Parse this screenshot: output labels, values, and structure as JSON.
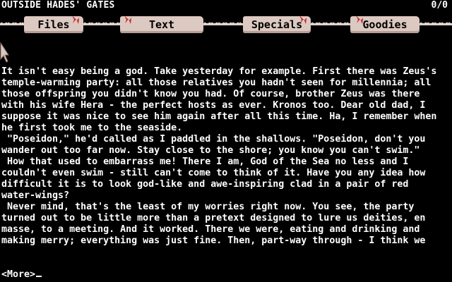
{
  "status": {
    "location": "OUTSIDE HADES' GATES",
    "score": "0/0"
  },
  "menu": {
    "items": [
      {
        "label": "Files"
      },
      {
        "label": "Text"
      },
      {
        "label": "Specials"
      },
      {
        "label": "Goodies"
      }
    ],
    "chain_glyph": "⊶⊶⊶⊶⊶⊶⊶⊶⊶⊶⊶⊶⊶⊶⊶⊶⊶⊶⊶⊶⊶⊶⊶⊶⊶⊶⊶⊶⊶⊶⊶⊶⊶⊶⊶⊶⊶⊶⊶⊶⊶⊶⊶⊶⊶⊶⊶⊶⊶⊶⊶⊶⊶⊶⊶⊶⊶⊶⊶⊶⊶⊶⊶⊶⊶⊶⊶⊶⊶⊶⊶⊶⊶⊶⊶⊶⊶⊶⊶⊶⊶",
    "tab_color": "#dcc9c1",
    "flame_color": "#c81f1f"
  },
  "story": {
    "lines": [
      "It isn't easy being a god. Take yesterday for example. First there was Zeus's",
      "temple-warming party: all those relatives you hadn't seen for millennia; all",
      "those offspring you didn't know you had. Of course, brother Zeus was there",
      "with his wife Hera - the perfect hosts as ever. Kronos too. Dear old dad, I",
      "suppose it was nice to see him again after all this time. Ha, I remember when",
      "he first took me to the seaside.",
      " \"Poseidon,\" he'd called as I paddled in the shallows. \"Poseidon, don't you",
      "wander out too far now. Stay close to the shore; you know you can't swim.\"",
      " How that used to embarrass me! There I am, God of the Sea no less and I",
      "couldn't even swim - still can't come to think of it. Have you any idea how",
      "difficult it is to look god-like and awe-inspiring clad in a pair of red",
      "water-wings?",
      " Never mind, that's the least of my worries right now. You see, the party",
      "turned out to be little more than a pretext designed to lure us deities, en",
      "masse, to a meeting. And it worked. There we were, eating and drinking and",
      "making merry; everything was just fine. Then, part-way through - I think we"
    ],
    "more_prompt": "<More>"
  }
}
